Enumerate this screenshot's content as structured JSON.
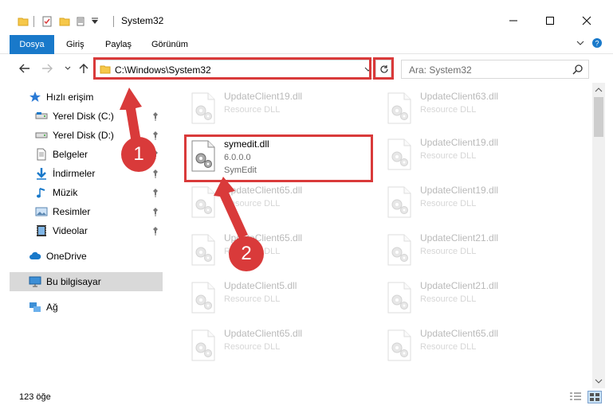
{
  "window": {
    "title": "System32"
  },
  "ribbon": {
    "tabs": [
      "Dosya",
      "Giriş",
      "Paylaş",
      "Görünüm"
    ],
    "active_index": 0
  },
  "address": {
    "path": "C:\\Windows\\System32"
  },
  "search": {
    "placeholder": "Ara: System32"
  },
  "sidebar": {
    "quick_access": "Hızlı erişim",
    "items": [
      {
        "label": "Yerel Disk (C:)",
        "icon": "drive-icon",
        "pinned": true
      },
      {
        "label": "Yerel Disk (D:)",
        "icon": "drive-icon",
        "pinned": true
      },
      {
        "label": "Belgeler",
        "icon": "documents-icon",
        "pinned": true
      },
      {
        "label": "İndirmeler",
        "icon": "downloads-icon",
        "pinned": true
      },
      {
        "label": "Müzik",
        "icon": "music-icon",
        "pinned": true
      },
      {
        "label": "Resimler",
        "icon": "pictures-icon",
        "pinned": true
      },
      {
        "label": "Videolar",
        "icon": "videos-icon",
        "pinned": true
      }
    ],
    "onedrive": "OneDrive",
    "this_pc": "Bu bilgisayar",
    "network": "Ağ"
  },
  "files": {
    "highlighted": {
      "name": "symedit.dll",
      "version": "6.0.0.0",
      "description": "SymEdit"
    },
    "col1": [
      {
        "name": "UpdateClient19.dll",
        "desc": "Resource DLL"
      },
      {
        "name": "UpdateClient65.dll",
        "desc": "Resource DLL"
      },
      {
        "name": "UpdateClient65.dll",
        "desc": "Resource DLL"
      },
      {
        "name": "UpdateClient5.dll",
        "desc": "Resource DLL"
      },
      {
        "name": "UpdateClient65.dll",
        "desc": "Resource DLL"
      }
    ],
    "col2": [
      {
        "name": "UpdateClient63.dll",
        "desc": "Resource DLL"
      },
      {
        "name": "UpdateClient19.dll",
        "desc": "Resource DLL"
      },
      {
        "name": "UpdateClient19.dll",
        "desc": "Resource DLL"
      },
      {
        "name": "UpdateClient21.dll",
        "desc": "Resource DLL"
      },
      {
        "name": "UpdateClient21.dll",
        "desc": "Resource DLL"
      },
      {
        "name": "UpdateClient65.dll",
        "desc": "Resource DLL"
      }
    ]
  },
  "status": {
    "item_count": "123 öğe"
  },
  "annotations": {
    "step1": "1",
    "step2": "2",
    "color": "#d93a3a"
  },
  "colors": {
    "accent": "#1979ca",
    "selected": "#d9d9d9"
  }
}
